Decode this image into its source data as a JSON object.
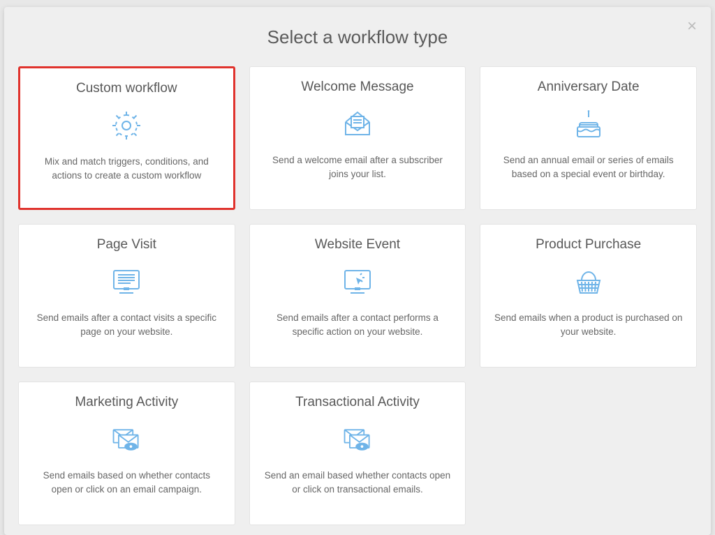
{
  "modal": {
    "title": "Select a workflow type",
    "close_label": "×"
  },
  "cards": [
    {
      "title": "Custom workflow",
      "desc": "Mix and match triggers, conditions, and actions to create a custom workflow",
      "highlighted": true
    },
    {
      "title": "Welcome Message",
      "desc": "Send a welcome email after a subscriber joins your list.",
      "highlighted": false
    },
    {
      "title": "Anniversary Date",
      "desc": "Send an annual email or series of emails based on a special event or birthday.",
      "highlighted": false
    },
    {
      "title": "Page Visit",
      "desc": "Send emails after a contact visits a specific page on your website.",
      "highlighted": false
    },
    {
      "title": "Website Event",
      "desc": "Send emails after a contact performs a specific action on your website.",
      "highlighted": false
    },
    {
      "title": "Product Purchase",
      "desc": "Send emails when a product is purchased on your website.",
      "highlighted": false
    },
    {
      "title": "Marketing Activity",
      "desc": "Send emails based on whether contacts open or click on an email campaign.",
      "highlighted": false
    },
    {
      "title": "Transactional Activity",
      "desc": "Send an email based whether contacts open or click on transactional emails.",
      "highlighted": false
    }
  ],
  "colors": {
    "accent": "#6fb4e8",
    "highlight": "#e0332d"
  }
}
